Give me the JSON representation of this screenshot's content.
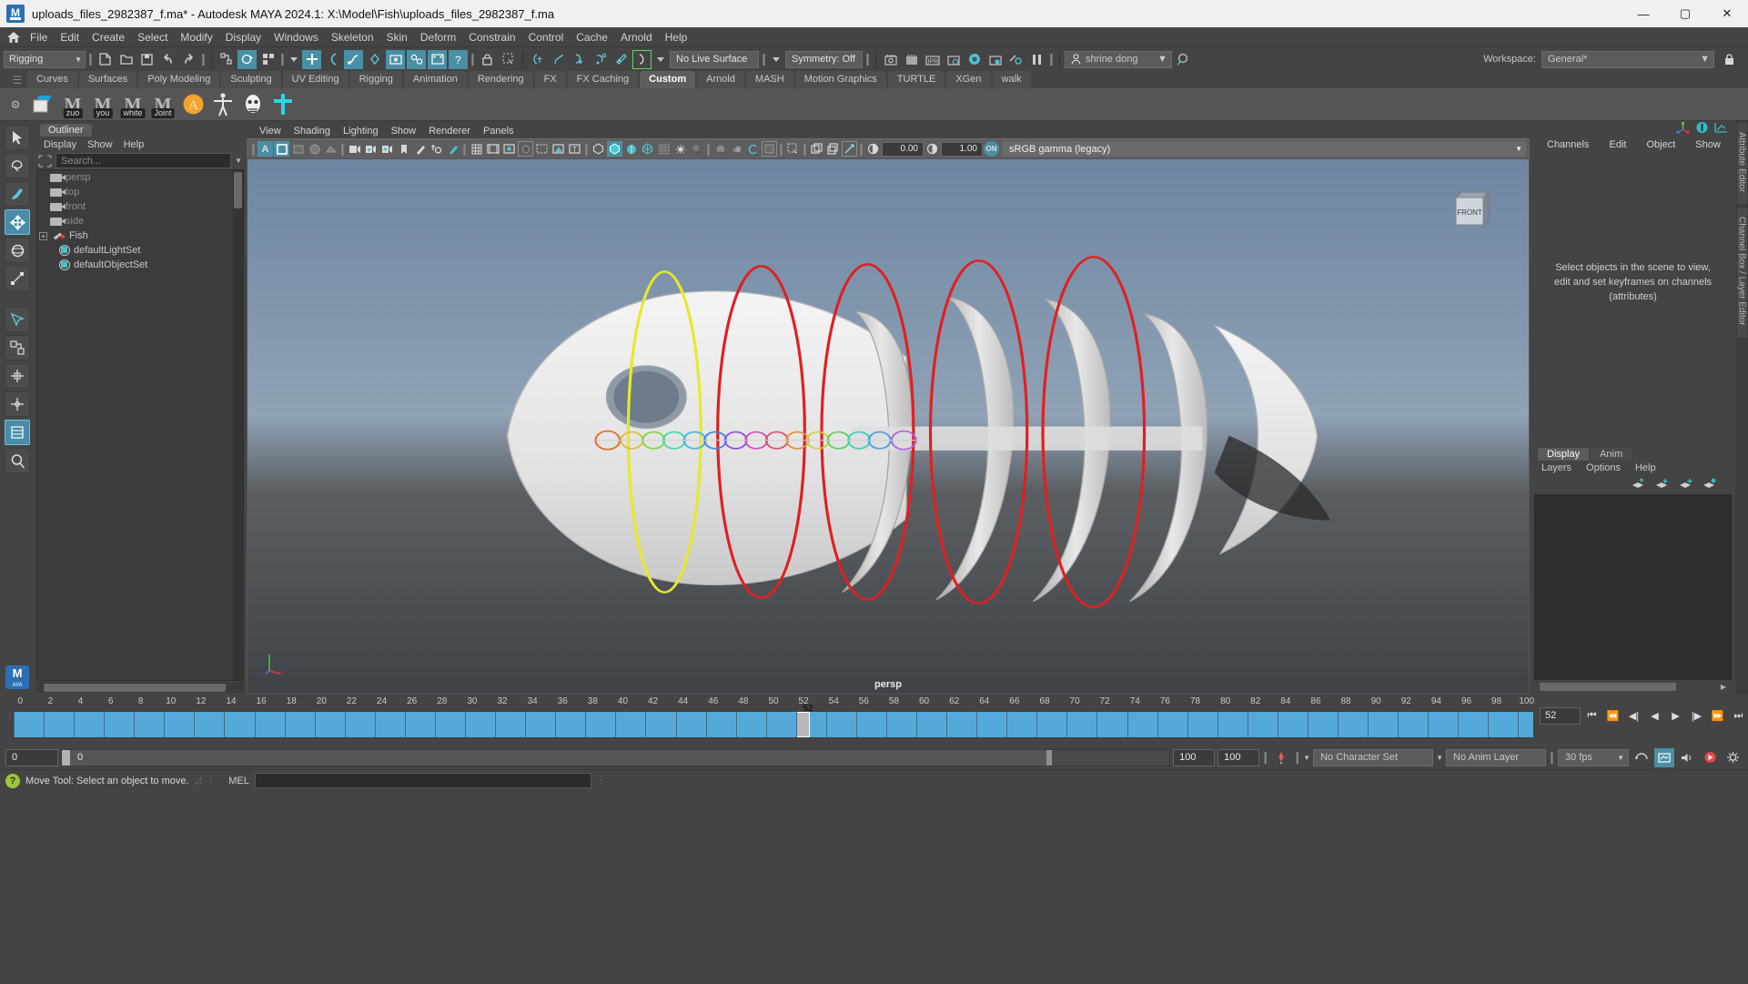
{
  "window": {
    "title": "uploads_files_2982387_f.ma* - Autodesk MAYA 2024.1: X:\\Model\\Fish\\uploads_files_2982387_f.ma",
    "minimize": "—",
    "maximize": "▢",
    "close": "✕"
  },
  "menubar": {
    "home_icon": "home-icon",
    "items": [
      "File",
      "Edit",
      "Create",
      "Select",
      "Modify",
      "Display",
      "Windows",
      "Skeleton",
      "Skin",
      "Deform",
      "Constrain",
      "Control",
      "Cache",
      "Arnold",
      "Help"
    ]
  },
  "statusline": {
    "menuset": "Rigging",
    "live_surface": "No Live Surface",
    "symmetry": "Symmetry: Off",
    "user": "shrine dong",
    "workspace_label": "Workspace:",
    "workspace_value": "General*",
    "lock_icon": "lock-icon",
    "search_icon": "search-icon"
  },
  "shelf": {
    "tabs": [
      "Curves",
      "Surfaces",
      "Poly Modeling",
      "Sculpting",
      "UV Editing",
      "Rigging",
      "Animation",
      "Rendering",
      "FX",
      "FX Caching",
      "Custom",
      "Arnold",
      "MASH",
      "Motion Graphics",
      "TURTLE",
      "XGen",
      "walk"
    ],
    "active_tab": "Custom",
    "buttons": [
      {
        "name": "polygon-plane-shelf",
        "label": ""
      },
      {
        "name": "mel-script-zuo",
        "label": "zuo"
      },
      {
        "name": "mel-script-you",
        "label": "you"
      },
      {
        "name": "mel-script-white",
        "label": "white"
      },
      {
        "name": "mel-script-joint",
        "label": "Joint"
      },
      {
        "name": "advanced-skeleton",
        "label": ""
      },
      {
        "name": "biped-rig",
        "label": ""
      },
      {
        "name": "face-rig",
        "label": ""
      },
      {
        "name": "joint-tool",
        "label": ""
      }
    ]
  },
  "toolbox": {
    "tools": [
      "select-tool",
      "lasso-select-tool",
      "paint-select-tool",
      "move-tool",
      "rotate-tool",
      "scale-tool",
      "last-tool",
      "soft-modification-tool",
      "show-manipulator-tool",
      "universal-manipulator-tool",
      "transform-tool-grid",
      "last-used-tool",
      "zoom-tool"
    ],
    "selected": "move-tool",
    "badge": "MAYA"
  },
  "outliner": {
    "tab": "Outliner",
    "menus": [
      "Display",
      "Show",
      "Help"
    ],
    "search_placeholder": "Search...",
    "nodes": [
      {
        "label": "persp",
        "icon": "camera-icon",
        "dim": true,
        "expand": false
      },
      {
        "label": "top",
        "icon": "camera-icon",
        "dim": true,
        "expand": false
      },
      {
        "label": "front",
        "icon": "camera-icon",
        "dim": true,
        "expand": false
      },
      {
        "label": "side",
        "icon": "camera-icon",
        "dim": true,
        "expand": false
      },
      {
        "label": "Fish",
        "icon": "mesh-icon",
        "dim": false,
        "expand": true
      },
      {
        "label": "defaultLightSet",
        "icon": "set-icon",
        "dim": false,
        "expand": false
      },
      {
        "label": "defaultObjectSet",
        "icon": "set-icon",
        "dim": false,
        "expand": false
      }
    ]
  },
  "viewport": {
    "menus": [
      "View",
      "Shading",
      "Lighting",
      "Show",
      "Renderer",
      "Panels"
    ],
    "exposure": "0.00",
    "gamma": "1.00",
    "color_profile": "sRGB gamma (legacy)",
    "camera_label": "persp",
    "view_cube_label": "FRONT",
    "axis": {
      "x": "x",
      "y": "y",
      "z": "z"
    }
  },
  "right_panel": {
    "menus": [
      "Channels",
      "Edit",
      "Object",
      "Show"
    ],
    "hint": "Select objects in the scene to view, edit and set keyframes on channels (attributes)",
    "dock_labels": [
      "Attribute Editor",
      "Channel Box / Layer Editor"
    ],
    "layers": {
      "tabs": [
        "Display",
        "Anim"
      ],
      "active_tab": "Display",
      "menus": [
        "Layers",
        "Options",
        "Help"
      ],
      "buttons": [
        "move-layer-up-icon",
        "move-layer-down-icon",
        "new-layer-icon",
        "new-layer-from-selected-icon"
      ]
    }
  },
  "timeline": {
    "tick_labels": [
      "0",
      "2",
      "4",
      "6",
      "8",
      "10",
      "12",
      "14",
      "16",
      "18",
      "20",
      "22",
      "24",
      "26",
      "28",
      "30",
      "32",
      "34",
      "36",
      "38",
      "40",
      "42",
      "44",
      "46",
      "48",
      "50",
      "52",
      "54",
      "56",
      "58",
      "60",
      "62",
      "64",
      "66",
      "68",
      "70",
      "72",
      "74",
      "76",
      "78",
      "80",
      "82",
      "84",
      "86",
      "88",
      "90",
      "92",
      "94",
      "96",
      "98",
      "100"
    ],
    "current_frame": "52",
    "current_frame_field": "52",
    "playback": [
      "go-to-start-icon",
      "step-back-keyframe-icon",
      "step-back-frame-icon",
      "play-backwards-icon",
      "play-forwards-icon",
      "step-forward-frame-icon",
      "step-forward-keyframe-icon",
      "go-to-end-icon"
    ]
  },
  "rangeslider": {
    "start_field": "0",
    "anim_start_field": "0",
    "anim_end_field": "100",
    "end_field": "100",
    "auto_key_icon": "auto-keyframe-icon",
    "char_set": "No Character Set",
    "anim_layer": "No Anim Layer",
    "fps": "30 fps",
    "right_icons": [
      "cycle-icon",
      "anim-preferences-icon",
      "sound-icon",
      "playback-options-icon",
      "preferences-icon"
    ]
  },
  "statusbar": {
    "help_icon": "help-icon",
    "help_text": "Move Tool: Select an object to move.",
    "mel_label": "MEL",
    "command_value": ""
  },
  "colors": {
    "accent": "#4a90a4",
    "highlight": "#54a9d8",
    "bg": "#444444",
    "panel": "#3c3c3c",
    "curve_yellow": "#e8e82a",
    "curve_red": "#e02020"
  }
}
